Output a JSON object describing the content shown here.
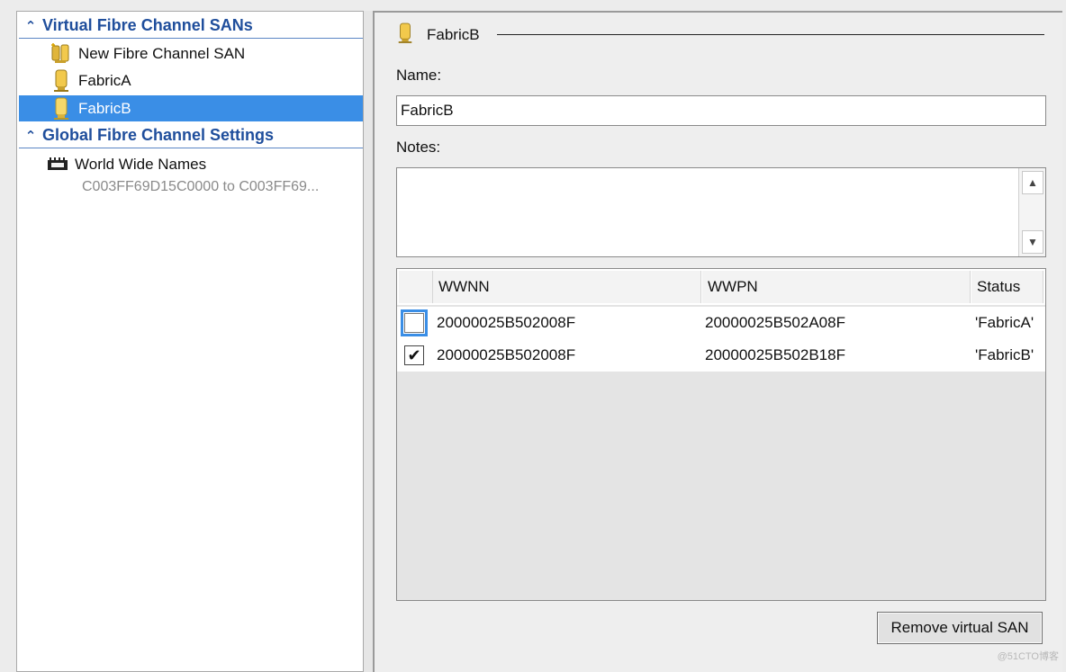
{
  "left_pane": {
    "section1": {
      "title": "Virtual Fibre Channel SANs",
      "icon": "double-chevron-up-icon"
    },
    "items": [
      {
        "label": "New Fibre Channel SAN",
        "icon": "new-san-icon"
      },
      {
        "label": "FabricA",
        "icon": "fabric-icon"
      },
      {
        "label": "FabricB",
        "icon": "fabric-icon",
        "selected": true
      }
    ],
    "section2": {
      "title": "Global Fibre Channel Settings",
      "icon": "double-chevron-up-icon"
    },
    "wwn": {
      "label": "World Wide Names",
      "sub": "C003FF69D15C0000 to C003FF69...",
      "icon": "wwn-chip-icon"
    }
  },
  "detail": {
    "group_title": "FabricB",
    "name_label": "Name:",
    "name_value": "FabricB",
    "notes_label": "Notes:",
    "notes_value": "",
    "grid": {
      "columns": [
        "WWNN",
        "WWPN",
        "Status"
      ],
      "rows": [
        {
          "checked": false,
          "wwnn": "20000025B502008F",
          "wwpn": "20000025B502A08F",
          "status": "'FabricA'"
        },
        {
          "checked": true,
          "wwnn": "20000025B502008F",
          "wwpn": "20000025B502B18F",
          "status": "'FabricB'"
        }
      ]
    },
    "remove_button": "Remove virtual SAN"
  },
  "watermark": "@51CTO博客",
  "colors": {
    "selection": "#3a8ee6",
    "section_header": "#1f4e9c",
    "fabric_icon": "#f2c94c"
  }
}
